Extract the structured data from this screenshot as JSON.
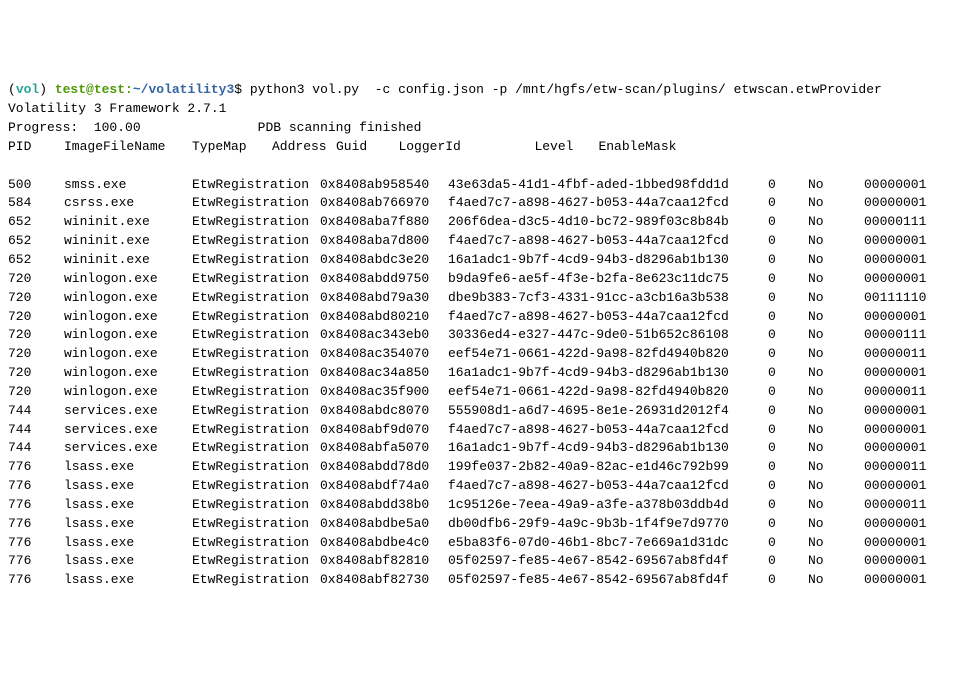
{
  "prompt": {
    "venv": "vol",
    "userhost": "test@test",
    "path": "~/volatility3",
    "command": "python3 vol.py  -c config.json -p /mnt/hgfs/etw-scan/plugins/ etwscan.etwProvider"
  },
  "banner": {
    "framework": "Volatility 3 Framework 2.7.1",
    "progress_label": "Progress:  100.00",
    "progress_status": "PDB scanning finished"
  },
  "headers": {
    "pid": "PID",
    "image": "ImageFileName",
    "typemap": "TypeMap",
    "address": "Address",
    "guid": "Guid",
    "logger": "LoggerId",
    "level": "Level",
    "mask": "EnableMask"
  },
  "rows": [
    {
      "pid": "500",
      "image": "smss.exe",
      "type": "EtwRegistration",
      "addr": "0x8408ab958540",
      "guid": "43e63da5-41d1-4fbf-aded-1bbed98fdd1d",
      "logger": "0",
      "level": "No",
      "mask": "00000001"
    },
    {
      "pid": "584",
      "image": "csrss.exe",
      "type": "EtwRegistration",
      "addr": "0x8408ab766970",
      "guid": "f4aed7c7-a898-4627-b053-44a7caa12fcd",
      "logger": "0",
      "level": "No",
      "mask": "00000001"
    },
    {
      "pid": "652",
      "image": "wininit.exe",
      "type": "EtwRegistration",
      "addr": "0x8408aba7f880",
      "guid": "206f6dea-d3c5-4d10-bc72-989f03c8b84b",
      "logger": "0",
      "level": "No",
      "mask": "00000111"
    },
    {
      "pid": "652",
      "image": "wininit.exe",
      "type": "EtwRegistration",
      "addr": "0x8408aba7d800",
      "guid": "f4aed7c7-a898-4627-b053-44a7caa12fcd",
      "logger": "0",
      "level": "No",
      "mask": "00000001"
    },
    {
      "pid": "652",
      "image": "wininit.exe",
      "type": "EtwRegistration",
      "addr": "0x8408abdc3e20",
      "guid": "16a1adc1-9b7f-4cd9-94b3-d8296ab1b130",
      "logger": "0",
      "level": "No",
      "mask": "00000001"
    },
    {
      "pid": "720",
      "image": "winlogon.exe",
      "type": "EtwRegistration",
      "addr": "0x8408abdd9750",
      "guid": "b9da9fe6-ae5f-4f3e-b2fa-8e623c11dc75",
      "logger": "0",
      "level": "No",
      "mask": "00000001"
    },
    {
      "pid": "720",
      "image": "winlogon.exe",
      "type": "EtwRegistration",
      "addr": "0x8408abd79a30",
      "guid": "dbe9b383-7cf3-4331-91cc-a3cb16a3b538",
      "logger": "0",
      "level": "No",
      "mask": "00111110"
    },
    {
      "pid": "720",
      "image": "winlogon.exe",
      "type": "EtwRegistration",
      "addr": "0x8408abd80210",
      "guid": "f4aed7c7-a898-4627-b053-44a7caa12fcd",
      "logger": "0",
      "level": "No",
      "mask": "00000001"
    },
    {
      "pid": "720",
      "image": "winlogon.exe",
      "type": "EtwRegistration",
      "addr": "0x8408ac343eb0",
      "guid": "30336ed4-e327-447c-9de0-51b652c86108",
      "logger": "0",
      "level": "No",
      "mask": "00000111"
    },
    {
      "pid": "720",
      "image": "winlogon.exe",
      "type": "EtwRegistration",
      "addr": "0x8408ac354070",
      "guid": "eef54e71-0661-422d-9a98-82fd4940b820",
      "logger": "0",
      "level": "No",
      "mask": "00000011"
    },
    {
      "pid": "720",
      "image": "winlogon.exe",
      "type": "EtwRegistration",
      "addr": "0x8408ac34a850",
      "guid": "16a1adc1-9b7f-4cd9-94b3-d8296ab1b130",
      "logger": "0",
      "level": "No",
      "mask": "00000001"
    },
    {
      "pid": "720",
      "image": "winlogon.exe",
      "type": "EtwRegistration",
      "addr": "0x8408ac35f900",
      "guid": "eef54e71-0661-422d-9a98-82fd4940b820",
      "logger": "0",
      "level": "No",
      "mask": "00000011"
    },
    {
      "pid": "744",
      "image": "services.exe",
      "type": "EtwRegistration",
      "addr": "0x8408abdc8070",
      "guid": "555908d1-a6d7-4695-8e1e-26931d2012f4",
      "logger": "0",
      "level": "No",
      "mask": "00000001"
    },
    {
      "pid": "744",
      "image": "services.exe",
      "type": "EtwRegistration",
      "addr": "0x8408abf9d070",
      "guid": "f4aed7c7-a898-4627-b053-44a7caa12fcd",
      "logger": "0",
      "level": "No",
      "mask": "00000001"
    },
    {
      "pid": "744",
      "image": "services.exe",
      "type": "EtwRegistration",
      "addr": "0x8408abfa5070",
      "guid": "16a1adc1-9b7f-4cd9-94b3-d8296ab1b130",
      "logger": "0",
      "level": "No",
      "mask": "00000001"
    },
    {
      "pid": "776",
      "image": "lsass.exe",
      "type": "EtwRegistration",
      "addr": "0x8408abdd78d0",
      "guid": "199fe037-2b82-40a9-82ac-e1d46c792b99",
      "logger": "0",
      "level": "No",
      "mask": "00000011"
    },
    {
      "pid": "776",
      "image": "lsass.exe",
      "type": "EtwRegistration",
      "addr": "0x8408abdf74a0",
      "guid": "f4aed7c7-a898-4627-b053-44a7caa12fcd",
      "logger": "0",
      "level": "No",
      "mask": "00000001"
    },
    {
      "pid": "776",
      "image": "lsass.exe",
      "type": "EtwRegistration",
      "addr": "0x8408abdd38b0",
      "guid": "1c95126e-7eea-49a9-a3fe-a378b03ddb4d",
      "logger": "0",
      "level": "No",
      "mask": "00000011"
    },
    {
      "pid": "776",
      "image": "lsass.exe",
      "type": "EtwRegistration",
      "addr": "0x8408abdbe5a0",
      "guid": "db00dfb6-29f9-4a9c-9b3b-1f4f9e7d9770",
      "logger": "0",
      "level": "No",
      "mask": "00000001"
    },
    {
      "pid": "776",
      "image": "lsass.exe",
      "type": "EtwRegistration",
      "addr": "0x8408abdbe4c0",
      "guid": "e5ba83f6-07d0-46b1-8bc7-7e669a1d31dc",
      "logger": "0",
      "level": "No",
      "mask": "00000001"
    },
    {
      "pid": "776",
      "image": "lsass.exe",
      "type": "EtwRegistration",
      "addr": "0x8408abf82810",
      "guid": "05f02597-fe85-4e67-8542-69567ab8fd4f",
      "logger": "0",
      "level": "No",
      "mask": "00000001"
    },
    {
      "pid": "776",
      "image": "lsass.exe",
      "type": "EtwRegistration",
      "addr": "0x8408abf82730",
      "guid": "05f02597-fe85-4e67-8542-69567ab8fd4f",
      "logger": "0",
      "level": "No",
      "mask": "00000001"
    }
  ]
}
